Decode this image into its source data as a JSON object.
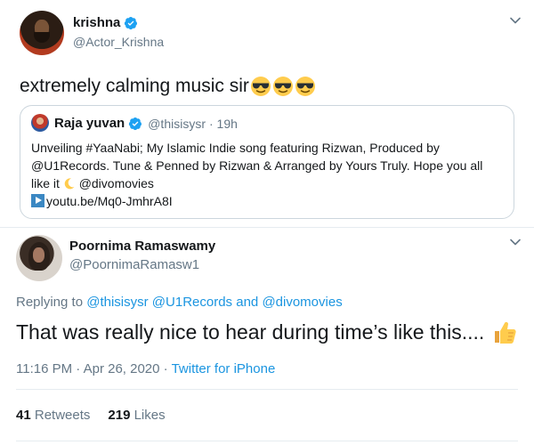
{
  "tweet1": {
    "display_name": "krishna",
    "handle": "@Actor_Krishna",
    "text": "extremely calming music sir",
    "emoji": [
      "smiling-face-with-sunglasses",
      "smiling-face-with-sunglasses",
      "smiling-face-with-sunglasses"
    ],
    "quoted": {
      "display_name": "Raja yuvan",
      "handle": "@thisisysr",
      "time": "· 19h",
      "line1": "Unveiling #YaaNabi; My Islamic Indie song featuring Rizwan, Produced by",
      "line2": "@U1Records. Tune & Penned by Rizwan & Arranged by Yours Truly. Hope you all",
      "line3_a": "like it",
      "line3_b": " @divomovies",
      "link": "youtu.be/Mq0-JmhrA8I"
    }
  },
  "tweet2": {
    "display_name": "Poornima Ramaswamy",
    "handle": "@PoornimaRamasw1",
    "reply_prefix": "Replying to ",
    "reply_to": [
      "@thisisysr",
      "@U1Records",
      "and",
      "@divomovies"
    ],
    "text": "That was really nice to hear during time’s like this....",
    "time": "11:16 PM · Apr 26, 2020 · ",
    "source": "Twitter for iPhone",
    "retweets_count": "41",
    "retweets_label": " Retweets",
    "likes_count": "219",
    "likes_label": " Likes"
  },
  "colors": {
    "link": "#1b95e0",
    "verified": "#1da1f2",
    "secondary_text": "#657786",
    "border": "#ccd6dd"
  }
}
